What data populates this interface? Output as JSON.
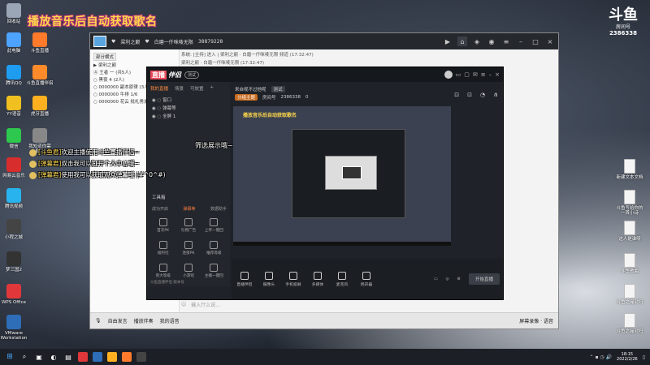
{
  "overlay": {
    "title": "播放音乐后自动获取歌名",
    "logo_mark": "斗鱼",
    "logo_sub": "房间号",
    "room_no": "2386338"
  },
  "desktop_left": [
    {
      "label": "回收站",
      "color": "#9aa6b5"
    },
    {
      "label": "此电脑",
      "color": "#4da3ff"
    },
    {
      "label": "腾讯QQ",
      "color": "#1e9cf0"
    },
    {
      "label": "YY语音",
      "color": "#f0c020"
    },
    {
      "label": "微信",
      "color": "#2dc84d"
    },
    {
      "label": "网易云音乐",
      "color": "#d82d2d"
    },
    {
      "label": "腾讯视频",
      "color": "#28b3ef"
    },
    {
      "label": "小程之城",
      "color": "#444"
    },
    {
      "label": "梦三国2",
      "color": "#333"
    },
    {
      "label": "WPS Office",
      "color": "#e0383a"
    },
    {
      "label": "VMware Workstation",
      "color": "#2e6db8"
    }
  ],
  "desktop_left2": [
    {
      "label": "斗鱼直播",
      "color": "#ff7a2a"
    },
    {
      "label": "斗鱼直播伴侣",
      "color": "#ff8a2a"
    },
    {
      "label": "虎牙直播",
      "color": "#ffb020"
    },
    {
      "label": "我知道你需要...",
      "color": "#888"
    }
  ],
  "desktop_right": [
    {
      "label": "新建文本文档"
    },
    {
      "label": "斗鱼写给你的一首小诗"
    },
    {
      "label": "这人是谁呀"
    },
    {
      "label": "斗鱼歌曲"
    },
    {
      "label": "斗鱼之缘对吗"
    },
    {
      "label": "斗鱼之缘对吗"
    }
  ],
  "main_window": {
    "nick": "梁利之巅",
    "channel": "白磨一仟咪唛无限",
    "room": "38879228",
    "left_tag": "部分横式",
    "left_rows": [
      "▶ 梁利之巅",
      "Ⓐ 王者 一  (共5人)",
      "○ 黑夜 4  (2人)",
      "○ 0000000  副本原律  (3人)",
      "○ 0000000  牛排  1/6",
      "○ 0000000  花云  批札男友"
    ],
    "header1": "系统: [主持] 进入  |  梁利之巅 · 白磨一仟咪唛无限  频道  (17:32:47)",
    "header2": "梁利之巅 · 白磨一仟咪唛无限  (17:32:47)",
    "input_placeholder": "输入什么说...",
    "bottom_items": [
      "自由发言",
      "播放伴奏",
      "我的语音"
    ],
    "right_controls": "屏幕录像 · 语音"
  },
  "obs": {
    "logo_box": "直播",
    "logo_text": "伴侣",
    "badge": "测试",
    "tabs": [
      "我的直播",
      "场景",
      "可放置"
    ],
    "scenes": [
      "窗口",
      "弹幕等",
      "全屏 1"
    ],
    "filter_title": "筛选展示哦~",
    "tool_title": "工具箱",
    "tool_tabs": [
      "成功开启",
      "弹幕等",
      "数据助手"
    ],
    "tools": [
      "首次PK",
      "礼物广告",
      "上传一键回",
      "福利社",
      "连接PK",
      "推荐等级",
      "贡大等级",
      "小游戏",
      "主播一键回"
    ],
    "status": "斗鱼直播伴侣 版本号",
    "head_row1": [
      "来自视不过他呢",
      "测试"
    ],
    "head_row2": [
      "分组主题",
      "房间号",
      "2386338",
      "0"
    ],
    "preview_title": "播放音乐后自动获取歌名",
    "bottom_tools": [
      "直播伴侣",
      "摄像头",
      "手机投屏",
      "多媒体",
      "麦克风",
      "扬声器"
    ],
    "start_label": "开始直播"
  },
  "chat": [
    {
      "name": "[斗鱼君]",
      "text": "欢迎主播使用斗鱼直播伴侣~"
    },
    {
      "name": "[弹幕君]",
      "text": "双击我可以打开个人中心哦~"
    },
    {
      "name": "[弹幕君]",
      "text": "使用我可以获取观众弹幕哦 (#^0^#)"
    }
  ],
  "banner": "筛选展示哦~",
  "taskbar": {
    "time": "18:15",
    "date": "2022/2/26",
    "apps": [
      "#e0383a",
      "#2e6db8",
      "#ffb020",
      "#ff7a2a",
      "#444"
    ]
  }
}
